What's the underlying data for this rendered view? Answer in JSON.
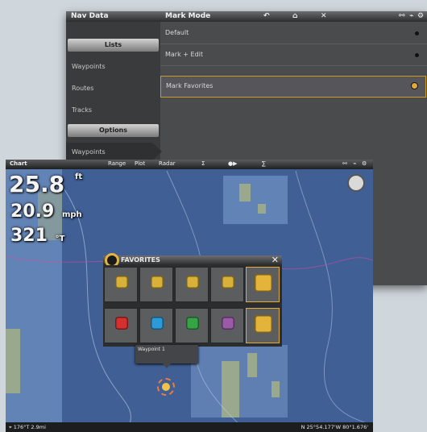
{
  "nav_panel": {
    "title": "Nav Data",
    "menu_title": "Mark Mode",
    "header_icons": [
      "back-arrow-icon",
      "home-icon",
      "close-icon",
      "network-icon",
      "signal-icon",
      "settings-icon"
    ],
    "left": {
      "section_lists": "Lists",
      "items": [
        "Waypoints",
        "Routes",
        "Tracks"
      ],
      "section_options": "Options",
      "options_items": [
        "Waypoints"
      ]
    },
    "right_items": [
      {
        "label": "Default",
        "selected": false
      },
      {
        "label": "Mark + Edit",
        "selected": false
      },
      {
        "label": "Mark Favorites",
        "selected": true
      }
    ]
  },
  "chart_panel": {
    "title": "Chart",
    "top_menu": [
      "Range",
      "Plot",
      "Radar",
      "Σ",
      "●▶",
      "∑"
    ],
    "readouts": {
      "depth": "25.8",
      "depth_unit": "ft",
      "speed": "20.9",
      "speed_unit": "mph",
      "heading": "321",
      "heading_unit": "°T"
    },
    "bottom": {
      "left": "⌖ 176°T  2.9mi",
      "right": "N 25°54.177'W 80°1.676'"
    },
    "marker_tooltip": "Waypoint 1"
  },
  "favorites": {
    "title": "FAVORITES",
    "close": "✕",
    "rows": [
      [
        {
          "color": "#d8b13a",
          "name": "yellow-flag-icon"
        },
        {
          "color": "#d8b13a",
          "name": "yellow-pin-icon"
        },
        {
          "color": "#d8b13a",
          "name": "yellow-waypoint-icon"
        },
        {
          "color": "#d8b13a",
          "name": "yellow-marker-icon"
        },
        {
          "color": "#e4b33a",
          "name": "favorite-pin-icon",
          "selected": true
        }
      ],
      [
        {
          "color": "#d43030",
          "name": "red-pin-icon"
        },
        {
          "color": "#2c9ad6",
          "name": "blue-pin-icon"
        },
        {
          "color": "#36a347",
          "name": "green-pin-icon"
        },
        {
          "color": "#9a5aa8",
          "name": "purple-pin-icon"
        },
        {
          "color": "#e4b33a",
          "name": "gold-pin-icon",
          "selected": true
        }
      ]
    ]
  },
  "colors": {
    "accent": "#e1ad3a",
    "nav_bg": "#4a4b4d",
    "chart_water": "#3f5f95"
  }
}
